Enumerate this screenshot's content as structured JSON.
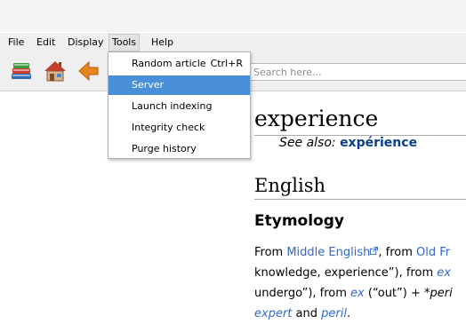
{
  "menubar": {
    "items": [
      {
        "label": "File"
      },
      {
        "label": "Edit"
      },
      {
        "label": "Display"
      },
      {
        "label": "Tools"
      },
      {
        "label": "Help"
      }
    ]
  },
  "toolbar": {
    "buttons": [
      {
        "icon": "library-books-icon"
      },
      {
        "icon": "home-icon"
      },
      {
        "icon": "back-arrow-icon"
      }
    ],
    "search_placeholder": "Search here..."
  },
  "tools_menu": {
    "items": [
      {
        "label": "Random article",
        "shortcut": "Ctrl+R"
      },
      {
        "label": "Server",
        "selected": true
      },
      {
        "label": "Launch indexing"
      },
      {
        "label": "Integrity check"
      },
      {
        "label": "Purge history"
      }
    ]
  },
  "article": {
    "title": "experience",
    "see_also_label": "See also:",
    "see_also_link": "expérience",
    "language_heading": "English",
    "section_heading": "Etymology",
    "line1": {
      "a": "From ",
      "link1": "Middle English",
      "b": ", from ",
      "link2": "Old Fr"
    },
    "line2": {
      "a": "knowledge, experience”), from ",
      "link": "ex"
    },
    "line3": {
      "a": "undergo”), from ",
      "link": "ex",
      "b": " (“out”) + ",
      "c": "*peri"
    },
    "line4": {
      "link1": "expert",
      "a": " and ",
      "link2": "peril",
      "b": "."
    }
  },
  "colors": {
    "link": "#3366cc",
    "see_also_link": "#0b3d91",
    "selection": "#4a90d9"
  }
}
